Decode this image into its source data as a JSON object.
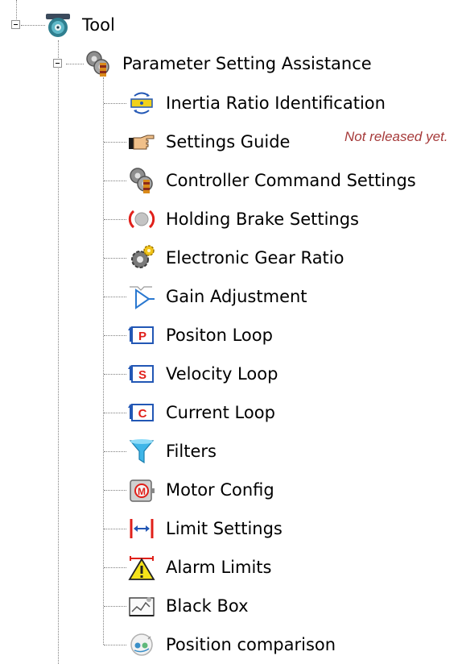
{
  "tree": {
    "root": {
      "label": "Tool",
      "icon": "tool-icon"
    },
    "group": {
      "label": "Parameter Setting Assistance",
      "icon": "parameter-gears-icon"
    },
    "items": [
      {
        "label": "Inertia Ratio Identification",
        "icon": "inertia-ratio-icon",
        "name": "tree-item-inertia-ratio-identification"
      },
      {
        "label": "Settings Guide",
        "icon": "pointing-hand-icon",
        "name": "tree-item-settings-guide"
      },
      {
        "label": "Controller Command Settings",
        "icon": "controller-gears-icon",
        "name": "tree-item-controller-command-settings"
      },
      {
        "label": "Holding Brake Settings",
        "icon": "holding-brake-icon",
        "name": "tree-item-holding-brake-settings"
      },
      {
        "label": "Electronic Gear Ratio",
        "icon": "gear-icon",
        "name": "tree-item-electronic-gear-ratio"
      },
      {
        "label": "Gain Adjustment",
        "icon": "gain-amplifier-icon",
        "name": "tree-item-gain-adjustment"
      },
      {
        "label": "Positon Loop",
        "icon": "position-loop-icon",
        "name": "tree-item-position-loop"
      },
      {
        "label": "Velocity Loop",
        "icon": "velocity-loop-icon",
        "name": "tree-item-velocity-loop"
      },
      {
        "label": "Current Loop",
        "icon": "current-loop-icon",
        "name": "tree-item-current-loop"
      },
      {
        "label": "Filters",
        "icon": "funnel-icon",
        "name": "tree-item-filters"
      },
      {
        "label": "Motor Config",
        "icon": "motor-icon",
        "name": "tree-item-motor-config"
      },
      {
        "label": "Limit Settings",
        "icon": "limit-arrows-icon",
        "name": "tree-item-limit-settings"
      },
      {
        "label": "Alarm Limits",
        "icon": "warning-triangle-icon",
        "name": "tree-item-alarm-limits"
      },
      {
        "label": "Black Box",
        "icon": "black-box-chart-icon",
        "name": "tree-item-black-box"
      },
      {
        "label": "Position comparison",
        "icon": "position-comparison-icon",
        "name": "tree-item-position-comparison"
      }
    ]
  },
  "annotation": {
    "text": "Not released yet."
  }
}
